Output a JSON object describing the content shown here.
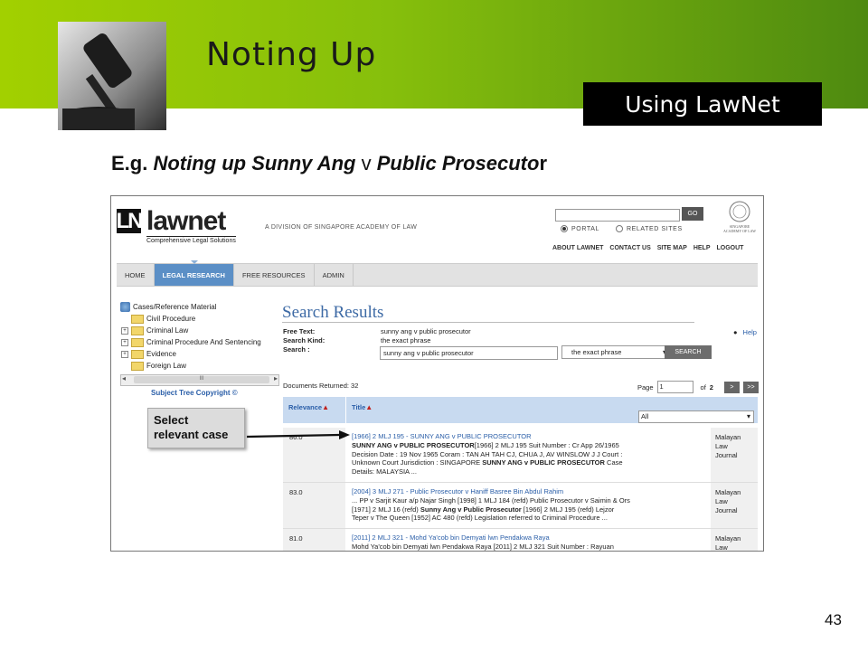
{
  "slide": {
    "title": "Noting Up",
    "badge": "Using LawNet",
    "subheading": {
      "prefix": "E.g. ",
      "case_a": "Noting up Sunny Ang",
      "mid": " v ",
      "case_b": "Public Prosecuto",
      "suffix": "r"
    },
    "page_number": "43",
    "accent": "#86bf0c"
  },
  "lawnet": {
    "logo_mark": "LN",
    "logo_word": "lawnet",
    "tagline": "Comprehensive Legal Solutions",
    "division": "A DIVISION OF SINGAPORE ACADEMY OF LAW",
    "go_label": "GO",
    "seal_caption": [
      "SINGAPORE",
      "ACADEMY OF LAW"
    ],
    "radio_portal": "PORTAL",
    "radio_related": "RELATED SITES",
    "top_links": [
      "ABOUT LAWNET",
      "CONTACT US",
      "SITE MAP",
      "HELP",
      "LOGOUT"
    ],
    "nav": [
      "HOME",
      "LEGAL RESEARCH",
      "FREE RESOURCES",
      "ADMIN"
    ],
    "active_nav_color": "#5b8fc6"
  },
  "tree": {
    "root": "Cases/Reference Material",
    "items": [
      "Civil Procedure",
      "Criminal Law",
      "Criminal Procedure And Sentencing",
      "Evidence",
      "Foreign Law"
    ],
    "expandable": [
      false,
      true,
      true,
      true,
      false
    ],
    "scroll_thumb": "III",
    "copyright": "Subject Tree Copyright ©"
  },
  "search": {
    "heading": "Search Results",
    "help": "Help",
    "free_text_label": "Free Text:",
    "free_text_value": "sunny ang v public prosecutor",
    "kind_label": "Search Kind:",
    "kind_value": "the exact phrase",
    "search_label": "Search :",
    "input_value": "sunny ang v public prosecutor",
    "kind_select": "the exact phrase",
    "search_button": "SEARCH",
    "documents_returned": "Documents Returned: 32",
    "page_label": "Page",
    "page_value": "1",
    "of_label": "of",
    "of_total": "2",
    "next": ">",
    "last": ">>"
  },
  "table": {
    "col_relevance": "Relevance",
    "col_title": "Title",
    "filter": "All",
    "rows": [
      {
        "score": "86.0",
        "link": "[1966] 2 MLJ 195 - SUNNY ANG v PUBLIC PROSECUTOR",
        "b1": "SUNNY ANG v PUBLIC PROSECUTOR",
        "t1": "[1966] 2 MLJ 195 Suit Number : Cr App 26/1965",
        "t2": "Decision Date : 19 Nov 1965 Coram : TAN AH TAH CJ, CHUA J, AV WINSLOW J J Court :",
        "t3": "Unknown Court Jurisdiction : SINGAPORE ",
        "b2": "SUNNY ANG v PUBLIC PROSECUTOR",
        "t4": " Case",
        "t5": "Details: MALAYSIA ...",
        "source": [
          "Malayan",
          "Law",
          "Journal"
        ]
      },
      {
        "score": "83.0",
        "link": "[2004] 3 MLJ 271 - Public Prosecutor v Haniff Basree Bin Abdul Rahim",
        "t1": "... PP v Sarjit Kaur a/p Najar Singh [1998] 1 MLJ 184 (refd) Public Prosecutor v Saimin & Ors",
        "t2a": "[1971] 2 MLJ 16 (refd) ",
        "b1": "Sunny Ang v Public Prosecutor",
        "t2b": " [1966] 2 MLJ 195 (refd) Lejzor",
        "t3": "Teper v The Queen [1952] AC 480 (refd) Legislation referred to Criminal Procedure ...",
        "source": [
          "Malayan",
          "Law",
          "Journal"
        ]
      },
      {
        "score": "81.0",
        "link": "[2011] 2 MLJ 321 - Mohd Ya'cob bin Demyati lwn Pendakwa Raya",
        "t1": "Mohd Ya'cob bin Demyati lwn Pendakwa Raya [2011] 2 MLJ 321 Suit Number : Rayuan",
        "source": [
          "Malayan",
          "Law"
        ]
      }
    ]
  },
  "callout": {
    "line1": "Select",
    "line2": "relevant case"
  }
}
